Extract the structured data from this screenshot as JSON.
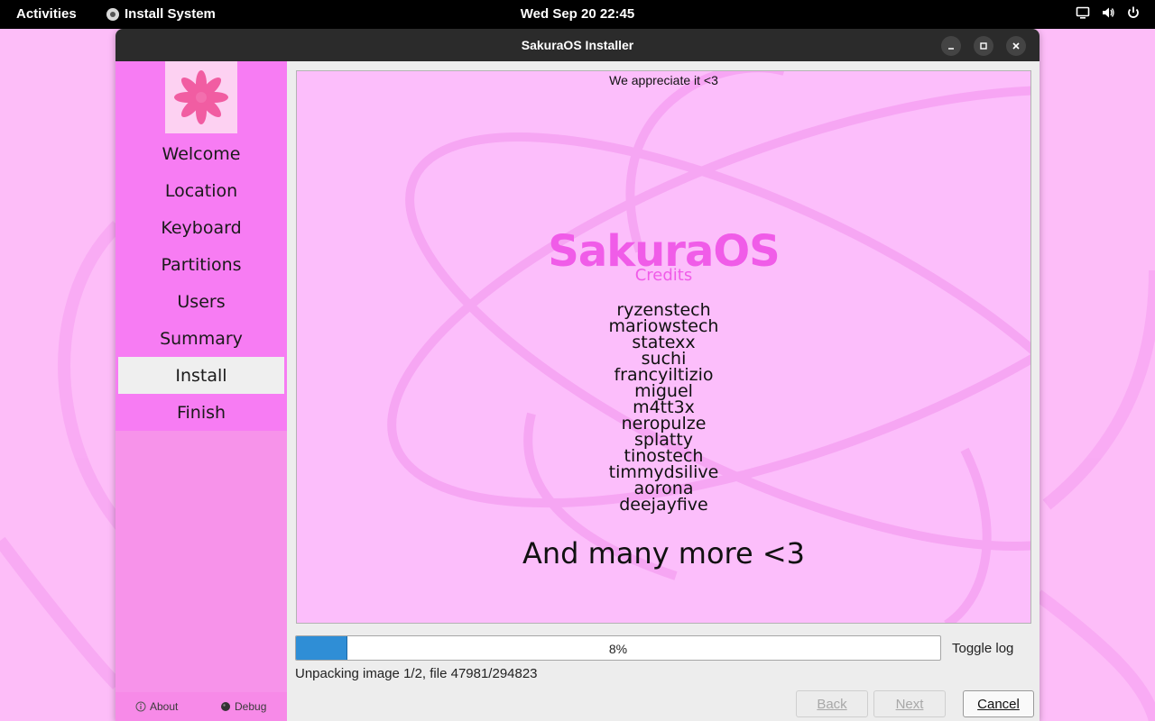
{
  "topbar": {
    "activities": "Activities",
    "app_name": "Install System",
    "app_icon": "disc-icon",
    "clock": "Wed Sep 20  22:45",
    "status_icons": [
      "screen-icon",
      "volume-icon",
      "power-icon"
    ]
  },
  "window": {
    "title": "SakuraOS Installer",
    "controls": [
      "minimize-icon",
      "maximize-icon",
      "close-icon"
    ]
  },
  "sidebar": {
    "logo_icon": "sakura-flower-icon",
    "items": [
      {
        "label": "Welcome",
        "active": false
      },
      {
        "label": "Location",
        "active": false
      },
      {
        "label": "Keyboard",
        "active": false
      },
      {
        "label": "Partitions",
        "active": false
      },
      {
        "label": "Users",
        "active": false
      },
      {
        "label": "Summary",
        "active": false
      },
      {
        "label": "Install",
        "active": true
      },
      {
        "label": "Finish",
        "active": false
      }
    ],
    "about_label": "About",
    "debug_label": "Debug"
  },
  "slideshow": {
    "top_text": "We appreciate it <3",
    "brand": "SakuraOS",
    "subtitle": "Credits",
    "credits": [
      "ryzenstech",
      "mariowstech",
      "statexx",
      "suchi",
      "francyiltizio",
      "miguel",
      "m4tt3x",
      "neropulze",
      "splatty",
      "tinostech",
      "timmydsilive",
      "aorona",
      "deejayfive"
    ],
    "footer": "And many more <3"
  },
  "progress": {
    "percent_text": "8%",
    "fraction": 0.08,
    "toggle_log": "Toggle log",
    "status": "Unpacking image 1/2, file 47981/294823"
  },
  "buttons": {
    "back": "Back",
    "next": "Next",
    "cancel": "Cancel"
  },
  "colors": {
    "desktop": "#fdbdf8",
    "sidebar": "#f77cf3",
    "brand_pink": "#f05ce8",
    "progress_fill": "#2f8ed6"
  }
}
